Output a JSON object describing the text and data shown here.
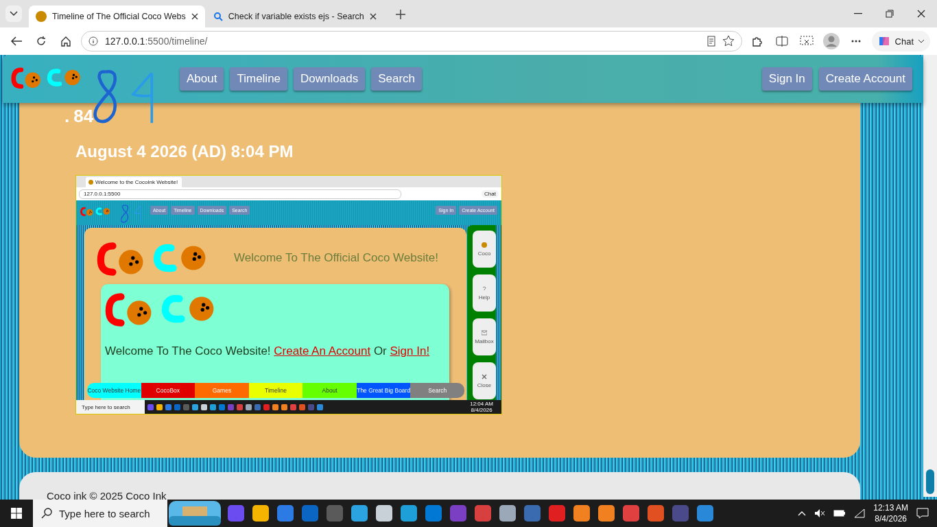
{
  "browser": {
    "tabs": [
      {
        "title": "Timeline of The Official Coco Webs",
        "selected": true
      },
      {
        "title": "Check if variable exists ejs - Search",
        "selected": false
      }
    ],
    "url_host": "127.0.0.1",
    "url_path": ":5500/timeline/",
    "chat_label": "Chat"
  },
  "site_header": {
    "nav_links": [
      "About",
      "Timeline",
      "Downloads",
      "Search"
    ],
    "account_buttons": [
      "Sign In",
      "Create Account"
    ]
  },
  "entry": {
    "marker": ".",
    "number": "84",
    "date": "August 4 2026 (AD) 8:04 PM",
    "screenshot": {
      "tab_title": "Welcome to the CocoInk Website!",
      "url": "127.0.0.1:5500",
      "chat_label": "Chat",
      "nav_links": [
        "About",
        "Timeline",
        "Downloads",
        "Search"
      ],
      "account_buttons": [
        "Sign In",
        "Create Account"
      ],
      "heading": "Welcome To The Official Coco Website!",
      "message": "Welcome To The Coco Website!",
      "link_create": "Create An Account",
      "joiner": "Or",
      "link_sign_in": "Sign In!",
      "side_buttons": [
        "Coco",
        "Help",
        "Mailbox",
        "Close"
      ],
      "bottom_nav": [
        {
          "label": "Coco Website Home",
          "color": "#00ffff"
        },
        {
          "label": "CocoBox",
          "color": "#e00000"
        },
        {
          "label": "Games",
          "color": "#ff6a00"
        },
        {
          "label": "Timeline",
          "color": "#eaff00"
        },
        {
          "label": "About",
          "color": "#66ff00"
        },
        {
          "label": "The Great Big Board",
          "color": "#0055ff"
        },
        {
          "label": "Search",
          "color": "#808080"
        }
      ],
      "taskbar": {
        "search_placeholder": "Type here to search",
        "time": "12:04 AM",
        "date": "8/4/2026"
      }
    }
  },
  "footer": {
    "copyright": "Coco ink © 2025 Coco Ink"
  },
  "taskbar": {
    "search_placeholder": "Type here to search",
    "time": "12:13 AM",
    "date": "8/4/2026"
  }
}
